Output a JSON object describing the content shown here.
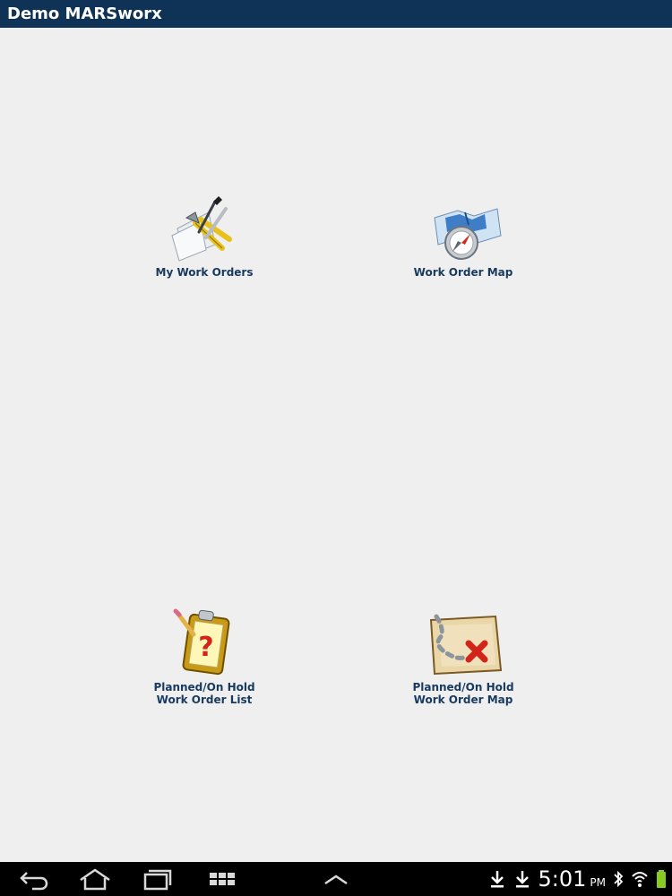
{
  "app": {
    "title": "Demo MARSworx"
  },
  "tiles": [
    {
      "id": "my-work-orders",
      "label": "My Work Orders",
      "icon": "tools-icon"
    },
    {
      "id": "work-order-map",
      "label": "Work Order Map",
      "icon": "map-compass-icon"
    },
    {
      "id": "planned-list",
      "label_line1": "Planned/On Hold",
      "label_line2": "Work Order List",
      "icon": "clipboard-question-icon"
    },
    {
      "id": "planned-map",
      "label_line1": "Planned/On Hold",
      "label_line2": "Work Order Map",
      "icon": "treasure-map-icon"
    }
  ],
  "status_bar": {
    "time": "5:01",
    "ampm": "PM",
    "icons": [
      "download-icon",
      "download-icon",
      "bluetooth-icon",
      "wifi-icon",
      "battery-icon"
    ]
  },
  "nav_bar": {
    "buttons": [
      "back-icon",
      "home-icon",
      "recent-apps-icon",
      "apps-grid-icon",
      "menu-up-icon"
    ]
  },
  "colors": {
    "titlebar": "#0f3257",
    "background": "#f0eff0",
    "label": "#173a5e",
    "navbar": "#000000"
  }
}
